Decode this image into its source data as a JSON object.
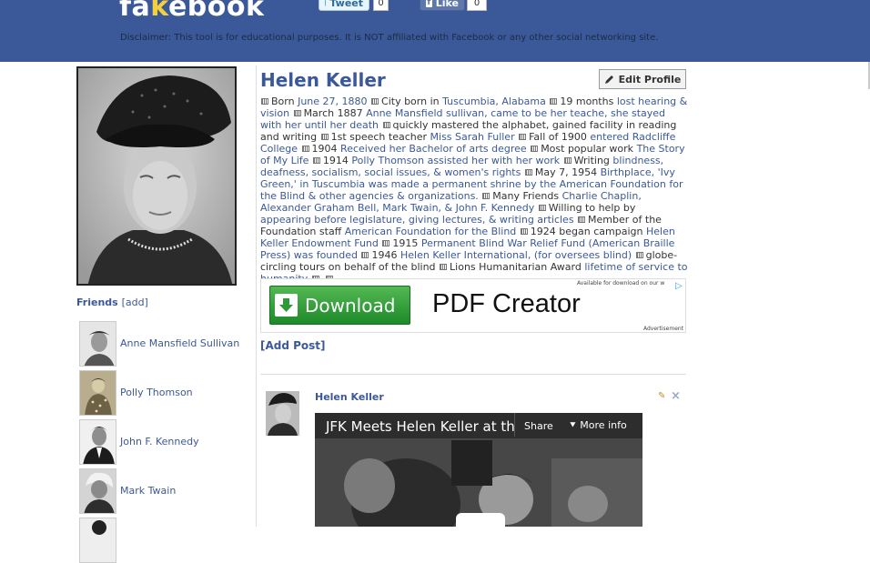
{
  "header": {
    "logo_fa": "fa",
    "logo_k": "k",
    "logo_rest": "ebook",
    "disclaimer": "Disclaimer: This tool is for educational purposes. It is NOT affiliated with Facebook or any other social networking site.",
    "tweet_label": "Tweet",
    "tweet_count": "0",
    "like_label": "Like",
    "like_count": "0"
  },
  "profile": {
    "name": "Helen Keller",
    "edit_label": "Edit Profile"
  },
  "info": [
    {
      "label": "Born",
      "value": "June 27, 1880"
    },
    {
      "label": "City born in",
      "value": "Tuscumbia, Alabama"
    },
    {
      "label": "19 months",
      "value": "lost hearing & vision"
    },
    {
      "label": "March 1887",
      "value": "Anne Mansfield sullivan, came to be her teache, she stayed with her until her death"
    },
    {
      "label": "quickly mastered the alphabet, gained facility in reading and writing",
      "value": ""
    },
    {
      "label": "1st speech teacher",
      "value": "Miss Sarah Fuller"
    },
    {
      "label": "Fall of 1900",
      "value": "entered Radcliffe College"
    },
    {
      "label": "1904",
      "value": "Received her Bachelor of arts degree"
    },
    {
      "label": "Most popular work",
      "value": "The Story of My Life"
    },
    {
      "label": "1914",
      "value": "Polly Thomson assisted her with her work"
    },
    {
      "label": "Writing",
      "value": "blindness, deafness, socialism, social issues, & women's rights"
    },
    {
      "label": "May 7, 1954",
      "value": "Birthplace, 'Ivy Green,' in Tuscumbia was made a permanent shrine by the American Foundation for the Blind & other agencies & organizations."
    },
    {
      "label": "Many Friends",
      "value": "Charlie Chaplin, Alexander Graham Bell, Mark Twain, & John F. Kennedy"
    },
    {
      "label": "Willing to help by",
      "value": "appearing before legislature, giving lectures, & writing articles"
    },
    {
      "label": "Member of the Foundation staff",
      "value": "American Foundation for the Blind"
    },
    {
      "label": "1924 began campaign",
      "value": "Helen Keller Endowment Fund"
    },
    {
      "label": "1915",
      "value": "Permanent Blind War Relief Fund (American Braille Press) was founded"
    },
    {
      "label": "1946",
      "value": "Helen Keller International, (for oversees blind)"
    },
    {
      "label": "globe-circling tours on behalf of the blind",
      "value": ""
    },
    {
      "label": "Lions Humanitarian Award",
      "value": "lifetime of service to humanity"
    },
    {
      "label": "",
      "value": ""
    },
    {
      "label": "",
      "value": ""
    }
  ],
  "friends": {
    "heading": "Friends",
    "add_label": "[add]",
    "items": [
      {
        "name": "Anne Mansfield Sullivan"
      },
      {
        "name": "Polly Thomson"
      },
      {
        "name": "John F. Kennedy"
      },
      {
        "name": "Mark Twain"
      },
      {
        "name": ""
      }
    ]
  },
  "ad": {
    "button_label": "Download",
    "product": "PDF Creator",
    "small_text": "Available for download on our w",
    "ad_label": "Advertisement"
  },
  "add_post_label": "[Add Post]",
  "post": {
    "author": "Helen Keller",
    "video_title": "JFK Meets Helen Keller at th",
    "share_label": "Share",
    "more_info_label": "More info"
  }
}
